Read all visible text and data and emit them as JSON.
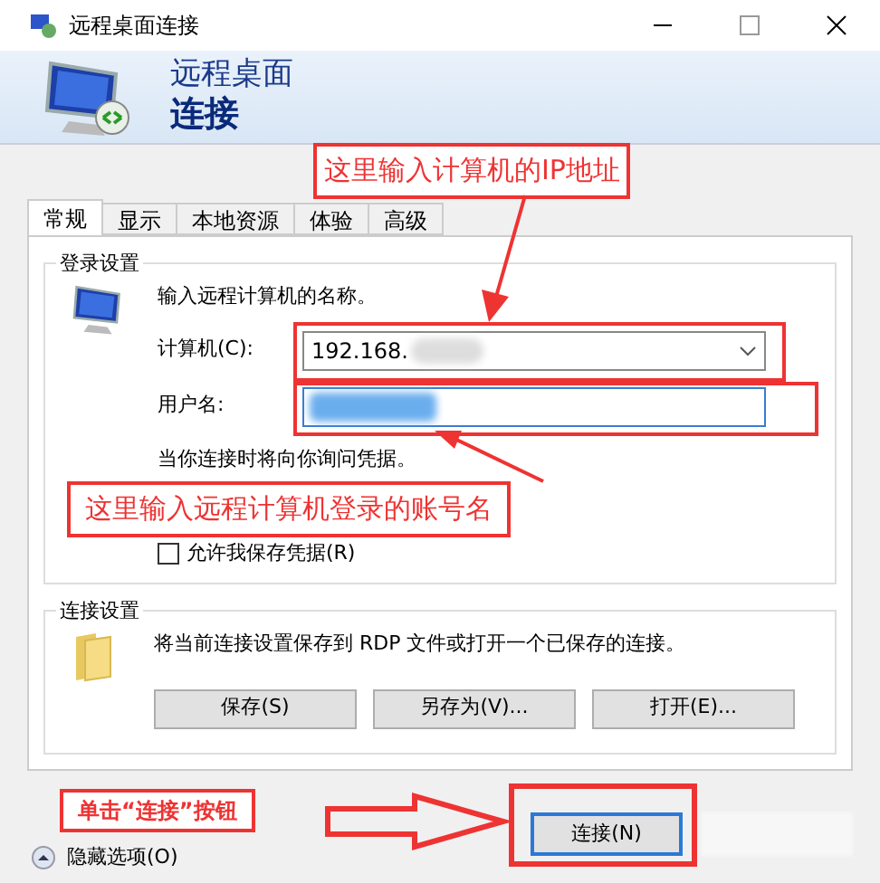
{
  "window": {
    "title": "远程桌面连接"
  },
  "header": {
    "line_1": "远程桌面",
    "line_2": "连接"
  },
  "tabs": [
    {
      "label": "常规",
      "selected": true
    },
    {
      "label": "显示",
      "selected": false
    },
    {
      "label": "本地资源",
      "selected": false
    },
    {
      "label": "体验",
      "selected": false
    },
    {
      "label": "高级",
      "selected": false
    }
  ],
  "login_group": {
    "title": "登录设置",
    "prompt": "输入远程计算机的名称。",
    "computer_label": "计算机(C):",
    "computer_value": "192.168.",
    "username_label": "用户名:",
    "note": "当你连接时将向你询问凭据。",
    "save_credentials": {
      "label": "允许我保存凭据(R)",
      "checked": false
    }
  },
  "connection_group": {
    "title": "连接设置",
    "description": "将当前连接设置保存到 RDP 文件或打开一个已保存的连接。",
    "buttons": [
      "保存(S)",
      "另存为(V)...",
      "打开(E)..."
    ]
  },
  "hide_options": "隐藏选项(O)",
  "connect_button": "连接(N)",
  "annotations": [
    {
      "text": "这里输入计算机的IP地址"
    },
    {
      "text": "这里输入远程计算机登录的账号名"
    },
    {
      "text": "单击“连接”按钮"
    }
  ]
}
